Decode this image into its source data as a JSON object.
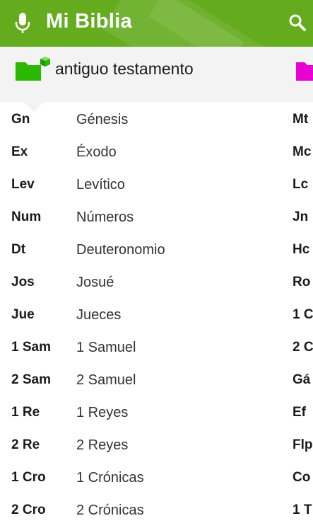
{
  "app": {
    "title": "Mi Biblia"
  },
  "section": {
    "title": "antiguo testamento",
    "folder_color": "#2bb800",
    "nt_folder_color": "#e800d0"
  },
  "theme": {
    "header_bg": "#64ab1e"
  },
  "icons": {
    "voice": "microphone-icon",
    "search": "search-icon"
  },
  "old_testament": [
    {
      "abbr": "Gn",
      "name": "Génesis"
    },
    {
      "abbr": "Ex",
      "name": "Éxodo"
    },
    {
      "abbr": "Lev",
      "name": "Levítico"
    },
    {
      "abbr": "Num",
      "name": "Números"
    },
    {
      "abbr": "Dt",
      "name": "Deuteronomio"
    },
    {
      "abbr": "Jos",
      "name": "Josué"
    },
    {
      "abbr": "Jue",
      "name": "Jueces"
    },
    {
      "abbr": "1 Sam",
      "name": "1 Samuel"
    },
    {
      "abbr": "2 Sam",
      "name": "2 Samuel"
    },
    {
      "abbr": "1 Re",
      "name": "1 Reyes"
    },
    {
      "abbr": "2 Re",
      "name": "2 Reyes"
    },
    {
      "abbr": "1 Cro",
      "name": "1 Crónicas"
    },
    {
      "abbr": "2 Cro",
      "name": "2 Crónicas"
    }
  ],
  "new_testament_partial": [
    "Mt",
    "Mc",
    "Lc",
    "Jn",
    "Hc",
    "Ro",
    "1 C",
    "2 C",
    "Gá",
    "Ef",
    "Flp",
    "Co",
    "1 T"
  ]
}
